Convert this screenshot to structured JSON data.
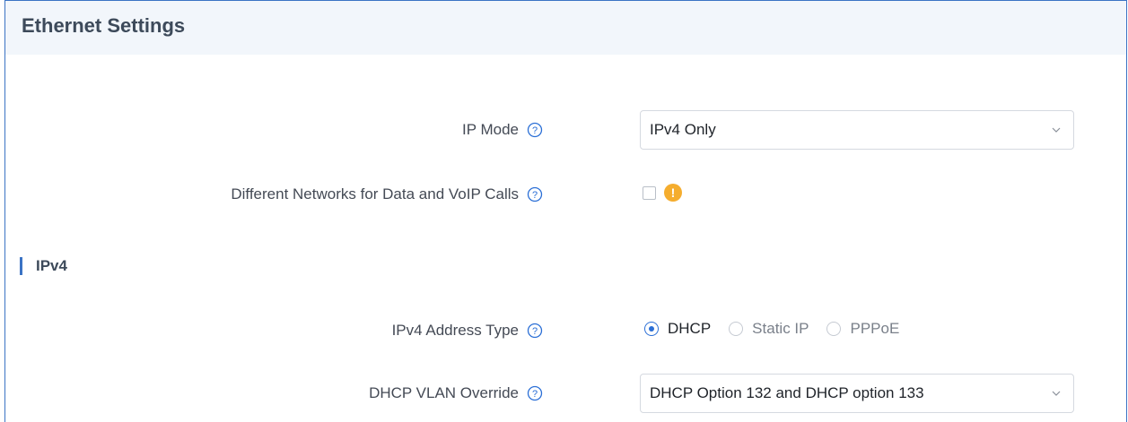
{
  "panel": {
    "title": "Ethernet Settings"
  },
  "ip_mode": {
    "label": "IP Mode",
    "value": "IPv4 Only"
  },
  "different_networks": {
    "label": "Different Networks for Data and VoIP Calls",
    "checked": false,
    "warning_icon": "exclamation-warning-icon",
    "warning_color": "#f5ad2e"
  },
  "ipv4_section": {
    "title": "IPv4"
  },
  "ipv4_address_type": {
    "label": "IPv4 Address Type",
    "options": [
      {
        "label": "DHCP",
        "selected": true
      },
      {
        "label": "Static IP",
        "selected": false
      },
      {
        "label": "PPPoE",
        "selected": false
      }
    ]
  },
  "dhcp_vlan_override": {
    "label": "DHCP VLAN Override",
    "value": "DHCP Option 132 and DHCP option 133"
  },
  "colors": {
    "accent": "#3b73c4",
    "radio_selected": "#2b6fd6",
    "header_bg": "#f2f6fb"
  }
}
